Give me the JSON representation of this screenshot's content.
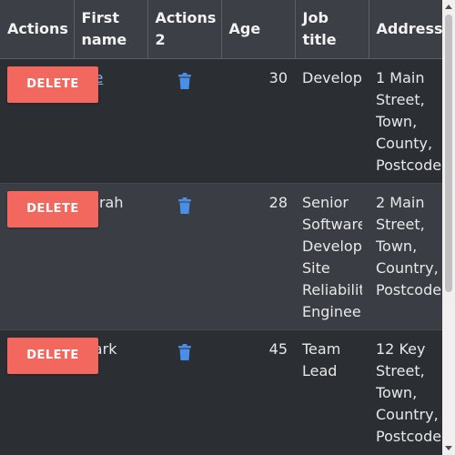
{
  "table": {
    "headers": {
      "actions": "Actions",
      "first_name": "First name",
      "actions2": "Actions 2",
      "age": "Age",
      "job_title": "Job title",
      "address": "Address"
    },
    "rows": [
      {
        "delete_label": "Delete",
        "first_name": "Joe",
        "age": "30",
        "job_title": [
          "Developer"
        ],
        "address": [
          "1 Main",
          "Street,",
          "Town,",
          "County,",
          "Postcode"
        ]
      },
      {
        "delete_label": "Delete",
        "first_name": "Sarah",
        "age": "28",
        "job_title": [
          "Senior",
          "Software",
          "Developer",
          "Site",
          "Reliability",
          "Engineer"
        ],
        "address": [
          "2 Main",
          "Street,",
          "Town,",
          "Country,",
          "Postcode"
        ]
      },
      {
        "delete_label": "Delete",
        "first_name": "Mark",
        "age": "45",
        "job_title": [
          "Team",
          "Lead"
        ],
        "address": [
          "12 Key",
          "Street,",
          "Town,",
          "Country,",
          "Postcode"
        ]
      }
    ]
  },
  "icons": {
    "trash": "trash-icon",
    "scroll_up": "chevron-up-icon",
    "scroll_down": "chevron-down-icon"
  },
  "colors": {
    "delete_button": "#f2685e",
    "link": "#8ab4f8",
    "trash_icon": "#4a8fe7",
    "header_bg": "#3c3f45",
    "row_dark": "#2b2e33",
    "row_light": "#3a3d43"
  }
}
